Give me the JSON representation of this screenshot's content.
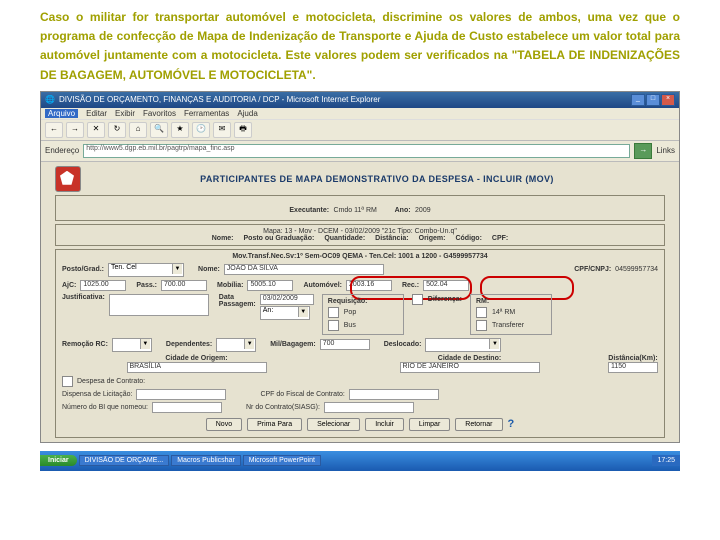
{
  "instruction": "Caso o militar for transportar automóvel e motocicleta, discrimine os valores de ambos, uma vez que o programa de confecção de Mapa de Indenização de Transporte e Ajuda de Custo estabelece um valor total para automóvel juntamente com a motocicleta. Este valores podem ser verificados na \"TABELA DE INDENIZAÇÕES DE BAGAGEM, AUTOMÓVEL E MOTOCICLETA\".",
  "window": {
    "title": "DIVISÃO DE ORÇAMENTO, FINANÇAS E AUDITORIA / DCP - Microsoft Internet Explorer",
    "menu": [
      "Arquivo",
      "Editar",
      "Exibir",
      "Favoritos",
      "Ferramentas",
      "Ajuda"
    ],
    "address_label": "Endereço",
    "address": "http://www5.dgp.eb.mil.br/pagtrp/mapa_finc.asp",
    "links": "Links"
  },
  "page": {
    "title": "PARTICIPANTES DE MAPA DEMONSTRATIVO DA DESPESA - INCLUIR (MOV)",
    "exec_row": {
      "exec_l": "Executante:",
      "exec_v": "Cmdo 11ª RM",
      "ano_l": "Ano:",
      "ano_v": "2009"
    },
    "mapa": {
      "title": "Mapa: 13 - Mov - DCEM - 03/02/2009 \"21c Tipo: Combo-Un.q\"",
      "headers": [
        "Nome:",
        "Posto ou Graduação:",
        "Quantidade:",
        "Distância:",
        "Origem:",
        "Código:",
        "CPF:"
      ]
    },
    "legend": "Mov.Transf.Nec.Sv:1º Sem-OC09 QEMA - Ten.Cel: 1001 a 1200 - G4599957734",
    "r1": {
      "posto_l": "Posto/Grad.:",
      "posto_v": "Ten. Cel",
      "nome_l": "Nome:",
      "nome_v": "JOAO DA SILVA",
      "cpf_l": "CPF/CNPJ:",
      "cpf_v": "04599957734"
    },
    "r2": {
      "ajc_l": "AjC:",
      "ajc_v": "1025.00",
      "pass_l": "Pass.:",
      "pass_v": "700.00",
      "mob_l": "Mobília:",
      "mob_v": "5005.10",
      "auto_l": "Automóvel:",
      "auto_v": "2003.16",
      "rec_l": "Rec.:",
      "rec_v": "502.04"
    },
    "r3": {
      "just_l": "Justificativa:",
      "dt_l": "Data\nPassagem:",
      "dt_v": "03/02/2009",
      "an_l": "An:",
      "an_v": "",
      "req_l": "Requisição:",
      "pop": "Pop",
      "bus": "Bus",
      "dif_l": "Diferença:",
      "rm_l": "RM:",
      "rm1": "14ª RM",
      "rm2": "Transferer"
    },
    "r4": {
      "rem_l": "Remoção RC:",
      "dep_l": "Dependentes:",
      "mil_l": "Mil/Bagagem:",
      "mil_v": "700",
      "des_l": "Deslocado:"
    },
    "r5": {
      "co_l": "Cidade de Origem:",
      "co_v": "BRASÍLIA",
      "cd_l": "Cidade de Destino:",
      "cd_v": "RIO DE JANEIRO",
      "dist_l": "Distância(Km):",
      "dist_v": "1150"
    },
    "r6": {
      "dc": "Despesa de Contrato:"
    },
    "r7": {
      "dl": "Dispensa de Licitação:",
      "cpf_l": "CPF do Fiscal de Contrato:"
    },
    "r8": {
      "bi_l": "Número do BI que nomeou:",
      "nc_l": "Nr do Contrato(SIASG):"
    },
    "buttons": [
      "Novo",
      "Prima Para",
      "Selecionar",
      "Incluir",
      "Limpar",
      "Retornar"
    ]
  },
  "taskbar": {
    "start": "Iniciar",
    "items": [
      "DIVISÃO DE ORÇAME...",
      "Macros Publicshar",
      "Microsoft PowerPoint"
    ],
    "clock": "17:25"
  }
}
